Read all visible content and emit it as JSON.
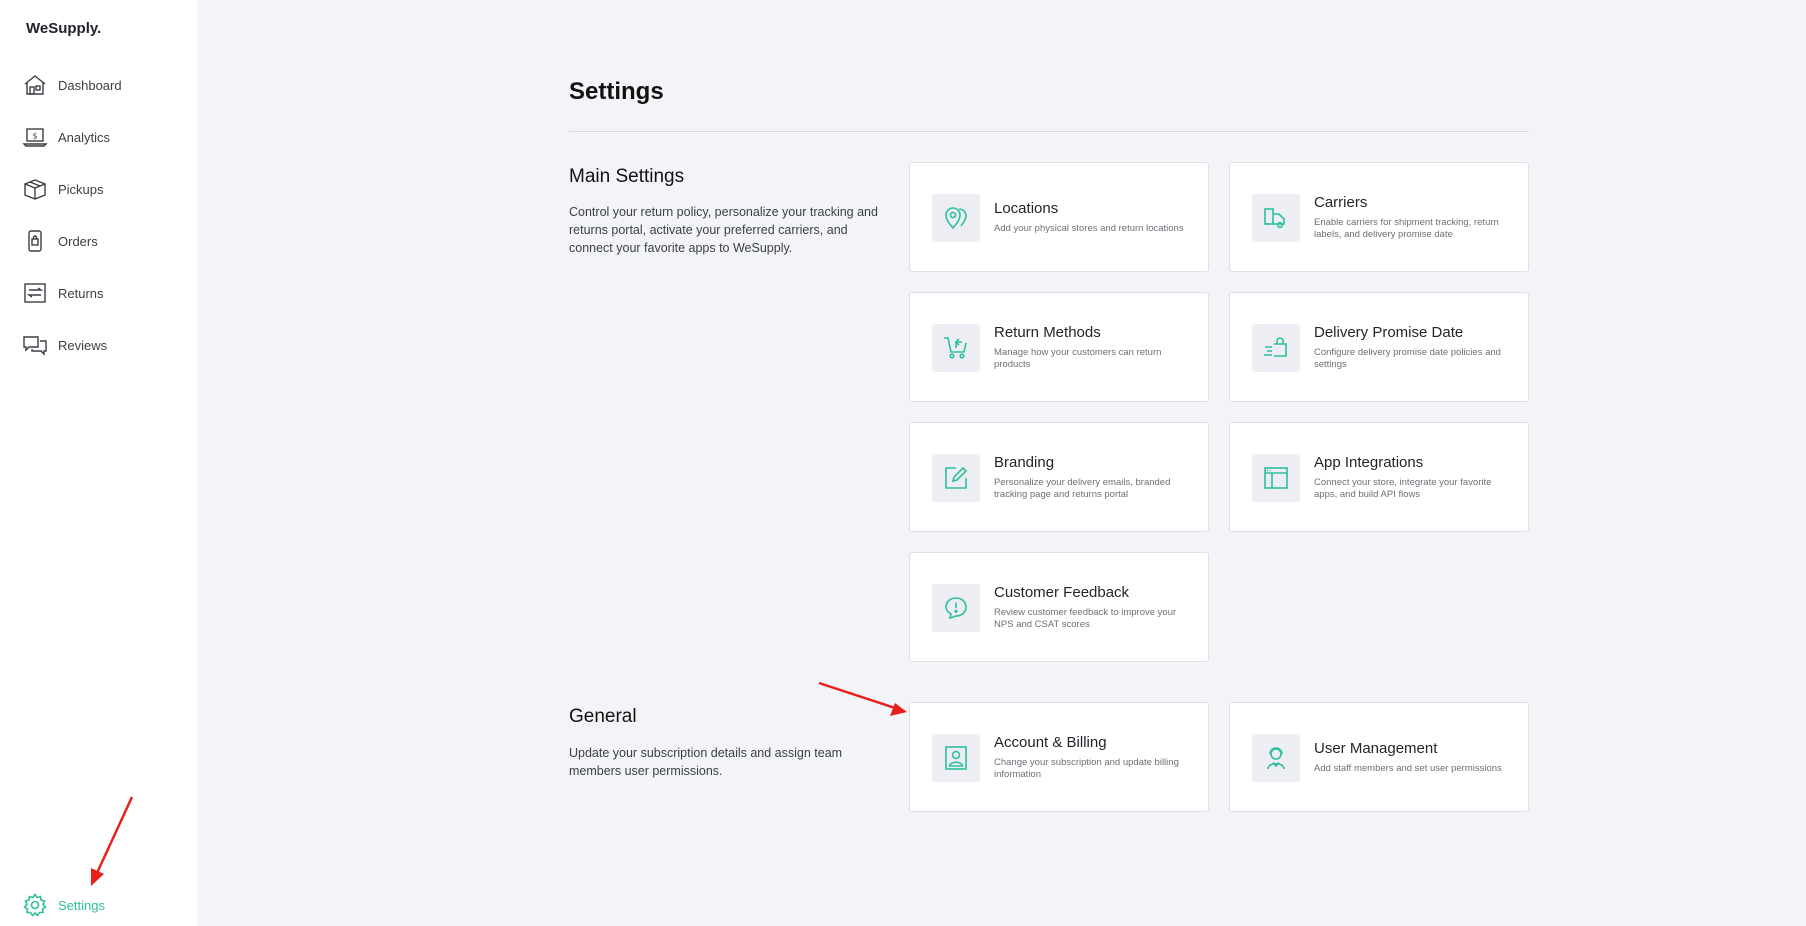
{
  "app": {
    "logo": "WeSupply."
  },
  "sidebar": {
    "items": [
      {
        "label": "Dashboard",
        "icon": "house-icon"
      },
      {
        "label": "Analytics",
        "icon": "laptop-dollar-icon"
      },
      {
        "label": "Pickups",
        "icon": "box-icon"
      },
      {
        "label": "Orders",
        "icon": "phone-bag-icon"
      },
      {
        "label": "Returns",
        "icon": "returns-icon"
      },
      {
        "label": "Reviews",
        "icon": "chat-bubbles-icon"
      }
    ],
    "settings_label": "Settings"
  },
  "page": {
    "title": "Settings"
  },
  "main_settings": {
    "title": "Main Settings",
    "description": "Control your return policy, personalize your tracking and returns portal, activate your preferred carriers, and connect your favorite apps to WeSupply.",
    "cards": [
      {
        "title": "Locations",
        "desc": "Add your physical stores and return locations",
        "icon": "location-pin-icon"
      },
      {
        "title": "Carriers",
        "desc": "Enable carriers for shipment tracking, return labels, and delivery promise date",
        "icon": "truck-icon"
      },
      {
        "title": "Return Methods",
        "desc": "Manage how your customers can return products",
        "icon": "cart-return-icon"
      },
      {
        "title": "Delivery Promise Date",
        "desc": "Configure delivery promise date policies and settings",
        "icon": "fast-delivery-icon"
      },
      {
        "title": "Branding",
        "desc": "Personalize your delivery emails, branded tracking page and returns portal",
        "icon": "edit-icon"
      },
      {
        "title": "App Integrations",
        "desc": "Connect your store, integrate your favorite apps, and build API flows",
        "icon": "window-icon"
      },
      {
        "title": "Customer Feedback",
        "desc": "Review customer feedback to improve your NPS and CSAT scores",
        "icon": "feedback-icon"
      }
    ]
  },
  "general": {
    "title": "General",
    "description": "Update your subscription details and assign team members user permissions.",
    "cards": [
      {
        "title": "Account & Billing",
        "desc": "Change your subscription and update billing information",
        "icon": "account-icon"
      },
      {
        "title": "User Management",
        "desc": "Add staff members and set user permissions",
        "icon": "user-headset-icon"
      }
    ]
  },
  "colors": {
    "accent": "#2fbf9c",
    "annotation": "#e8201c"
  }
}
